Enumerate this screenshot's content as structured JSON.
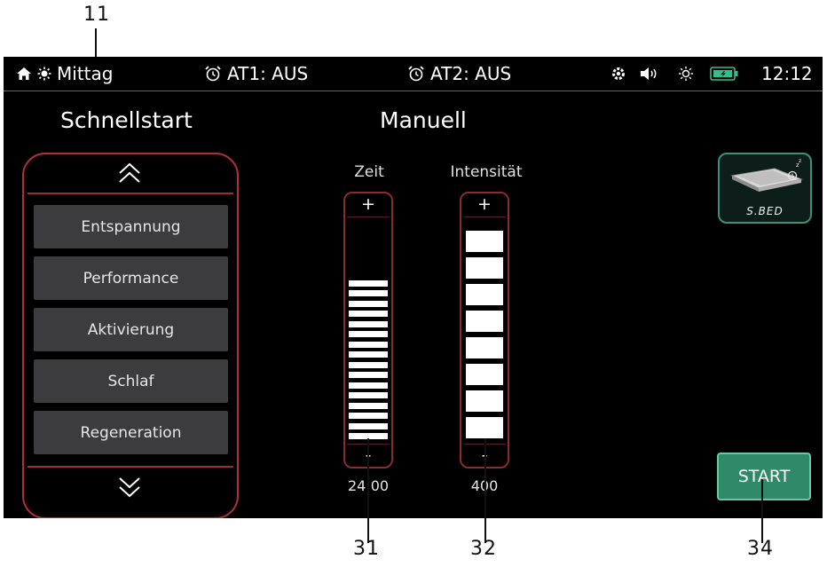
{
  "callouts": {
    "status_bar": "11",
    "time_slider": "31",
    "intensity_slider": "32",
    "start_button": "34"
  },
  "status_bar": {
    "mode": "Mittag",
    "alarm1": "AT1: AUS",
    "alarm2": "AT2: AUS",
    "clock": "12:12",
    "icons": [
      "home-icon",
      "sun-icon",
      "alarm-clock-icon",
      "gear-icon",
      "speaker-icon",
      "brightness-icon",
      "battery-icon"
    ]
  },
  "quickstart": {
    "title": "Schnellstart",
    "presets": [
      "Entspannung",
      "Performance",
      "Aktivierung",
      "Schlaf",
      "Regeneration"
    ]
  },
  "manual": {
    "title": "Manuell",
    "time": {
      "label": "Zeit",
      "plus": "+",
      "minus": "-",
      "value": "24:00",
      "level_bars": 16
    },
    "intensity": {
      "label": "Intensität",
      "plus": "+",
      "minus": "-",
      "value": "400",
      "level_bars": 8
    }
  },
  "device": {
    "label": "S.BED"
  },
  "start_button": {
    "label": "START"
  },
  "colors": {
    "accent_red": "#a8343b",
    "start_green": "#2f8a6a",
    "device_border": "#3f8f7b"
  }
}
